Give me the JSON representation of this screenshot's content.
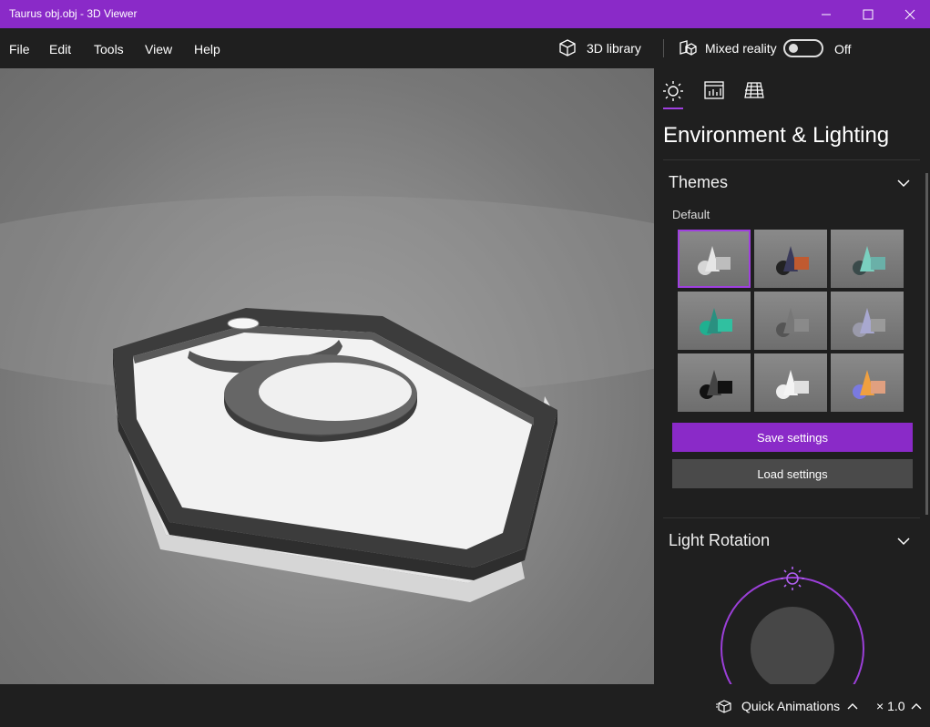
{
  "window": {
    "title": "Taurus obj.obj - 3D Viewer"
  },
  "menu": {
    "file": "File",
    "edit": "Edit",
    "tools": "Tools",
    "view": "View",
    "help": "Help"
  },
  "toolbar": {
    "library_label": "3D library",
    "mixed_reality_label": "Mixed reality",
    "toggle_state": "Off"
  },
  "panel": {
    "title": "Environment & Lighting",
    "themes": {
      "title": "Themes",
      "default_label": "Default",
      "selected_index": 0
    },
    "save_label": "Save settings",
    "load_label": "Load settings",
    "light_rotation": {
      "title": "Light Rotation"
    }
  },
  "statusbar": {
    "quick_animations_label": "Quick Animations",
    "speed": "× 1.0"
  },
  "colors": {
    "accent": "#8a2ac8",
    "title_bar": "#8a2ac8",
    "background": "#1f1f1f",
    "ring": "#9b3fd8"
  }
}
